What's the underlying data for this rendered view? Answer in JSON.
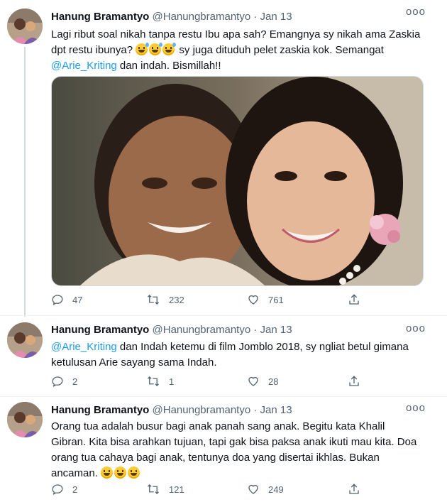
{
  "tweets": [
    {
      "name": "Hanung Bramantyo",
      "handle": "@Hanungbramantyo",
      "sep": "·",
      "time": "Jan 13",
      "more": "ooo",
      "text_part1": "Lagi ribut soal nikah tanpa restu Ibu apa sah? Emangnya sy nikah ama Zaskia\ndpt restu ibunya? ",
      "text_part2": " sy juga dituduh pelet zaskia kok. Semangat\n",
      "mention": "@Arie_Kriting",
      "text_part3": " dan indah. Bismillah!!",
      "emoji": [
        "sweat-smile",
        "sweat-smile",
        "sweat-smile"
      ],
      "replies": "47",
      "retweets": "232",
      "likes": "761"
    },
    {
      "name": "Hanung Bramantyo",
      "handle": "@Hanungbramantyo",
      "sep": "·",
      "time": "Jan 13",
      "more": "ooo",
      "mention": "@Arie_Kriting",
      "text": " dan Indah ketemu di film Jomblo 2018, sy ngliat betul gimana\nketulusan Arie sayang sama Indah.",
      "replies": "2",
      "retweets": "1",
      "likes": "28"
    },
    {
      "name": "Hanung Bramantyo",
      "handle": "@Hanungbramantyo",
      "sep": "·",
      "time": "Jan 13",
      "more": "ooo",
      "text": "Orang tua adalah busur bagi anak panah sang anak. Begitu kata Khalil\nGibran. Kita bisa arahkan tujuan, tapi gak bisa paksa anak ikuti mau kita. Doa\norang tua cahaya bagi anak, tentunya doa yang disertai ikhlas. Bukan\nancaman. ",
      "emoji": [
        "grinning",
        "grinning",
        "grinning"
      ],
      "replies": "2",
      "retweets": "121",
      "likes": "249"
    }
  ],
  "icons": {
    "reply": "reply-icon",
    "retweet": "retweet-icon",
    "like": "heart-icon",
    "share": "share-icon",
    "more": "more-icon"
  },
  "colors": {
    "mention": "#1d9bf0",
    "secondary": "#536471",
    "thread_line": "#cfd9de"
  }
}
